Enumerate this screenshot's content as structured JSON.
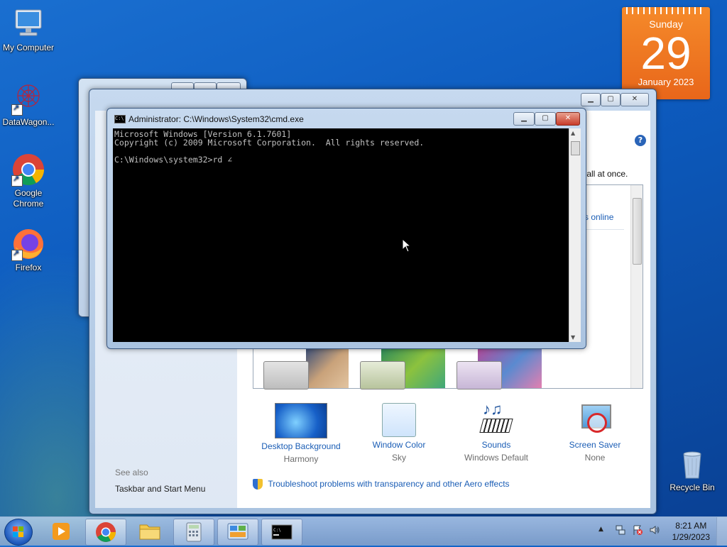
{
  "desktop": {
    "icons": [
      {
        "label": "My Computer"
      },
      {
        "label": "DataWagon..."
      },
      {
        "label": "Google Chrome"
      },
      {
        "label": "Firefox"
      },
      {
        "label": "Recycle Bin"
      }
    ]
  },
  "calendar": {
    "weekday": "Sunday",
    "day": "29",
    "month_year": "January 2023"
  },
  "cmd": {
    "title": "Administrator: C:\\Windows\\System32\\cmd.exe",
    "lines": [
      "Microsoft Windows [Version 6.1.7601]",
      "Copyright (c) 2009 Microsoft Corporation.  All rights reserved.",
      "",
      "C:\\Windows\\system32>rd ∠"
    ]
  },
  "personalization": {
    "description_fragment": "r all at once.",
    "online_link": "s online",
    "see_also": "See also",
    "taskbar_link": "Taskbar and Start Menu",
    "troubleshoot": "Troubleshoot problems with transparency and other Aero effects",
    "items": [
      {
        "label": "Desktop Background",
        "value": "Harmony"
      },
      {
        "label": "Window Color",
        "value": "Sky"
      },
      {
        "label": "Sounds",
        "value": "Windows Default"
      },
      {
        "label": "Screen Saver",
        "value": "None"
      }
    ]
  },
  "taskbar": {
    "time": "8:21 AM",
    "date": "1/29/2023"
  },
  "colors": {
    "link": "#1a5db5",
    "calendar": "#f07a22",
    "close": "#c83b2a"
  }
}
